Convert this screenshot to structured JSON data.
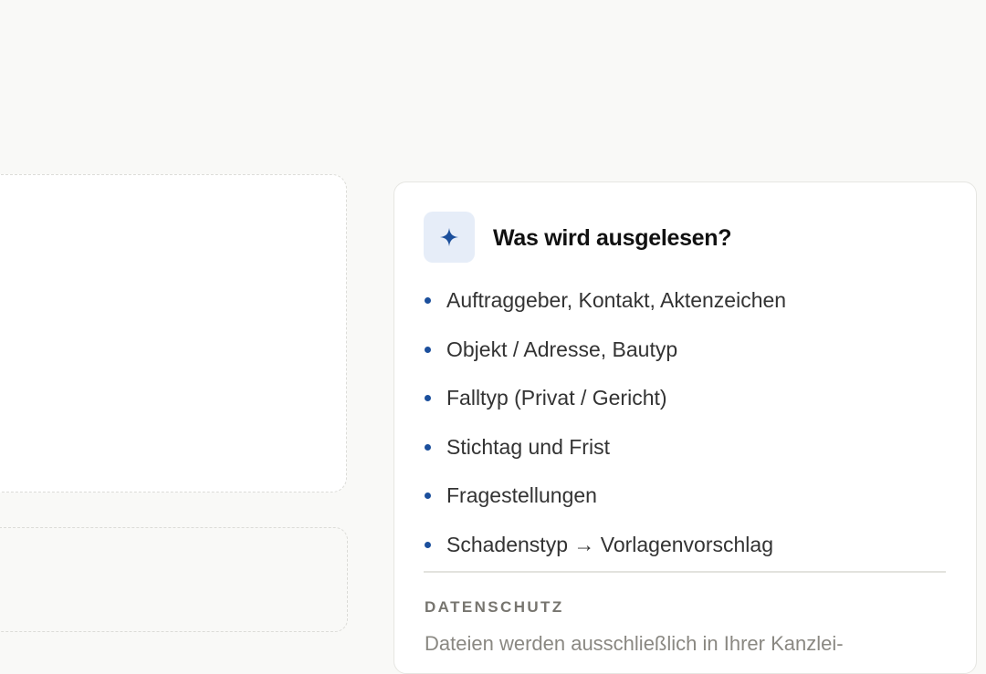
{
  "info_card": {
    "icon": "sparkle-icon",
    "title": "Was wird ausgelesen?",
    "items": [
      "Auftraggeber, Kontakt, Aktenzeichen",
      "Objekt / Adresse, Bautyp",
      "Falltyp (Privat / Gericht)",
      "Stichtag und Frist",
      "Fragestellungen",
      "Schadenstyp → Vorlagenvorschlag"
    ],
    "privacy_label": "DATENSCHUTZ",
    "privacy_text": "Dateien werden ausschließlich in Ihrer Kanzlei-"
  },
  "colors": {
    "accent": "#1b4f9c",
    "icon_background": "#e6edf8",
    "page_background": "#f9f9f7"
  }
}
